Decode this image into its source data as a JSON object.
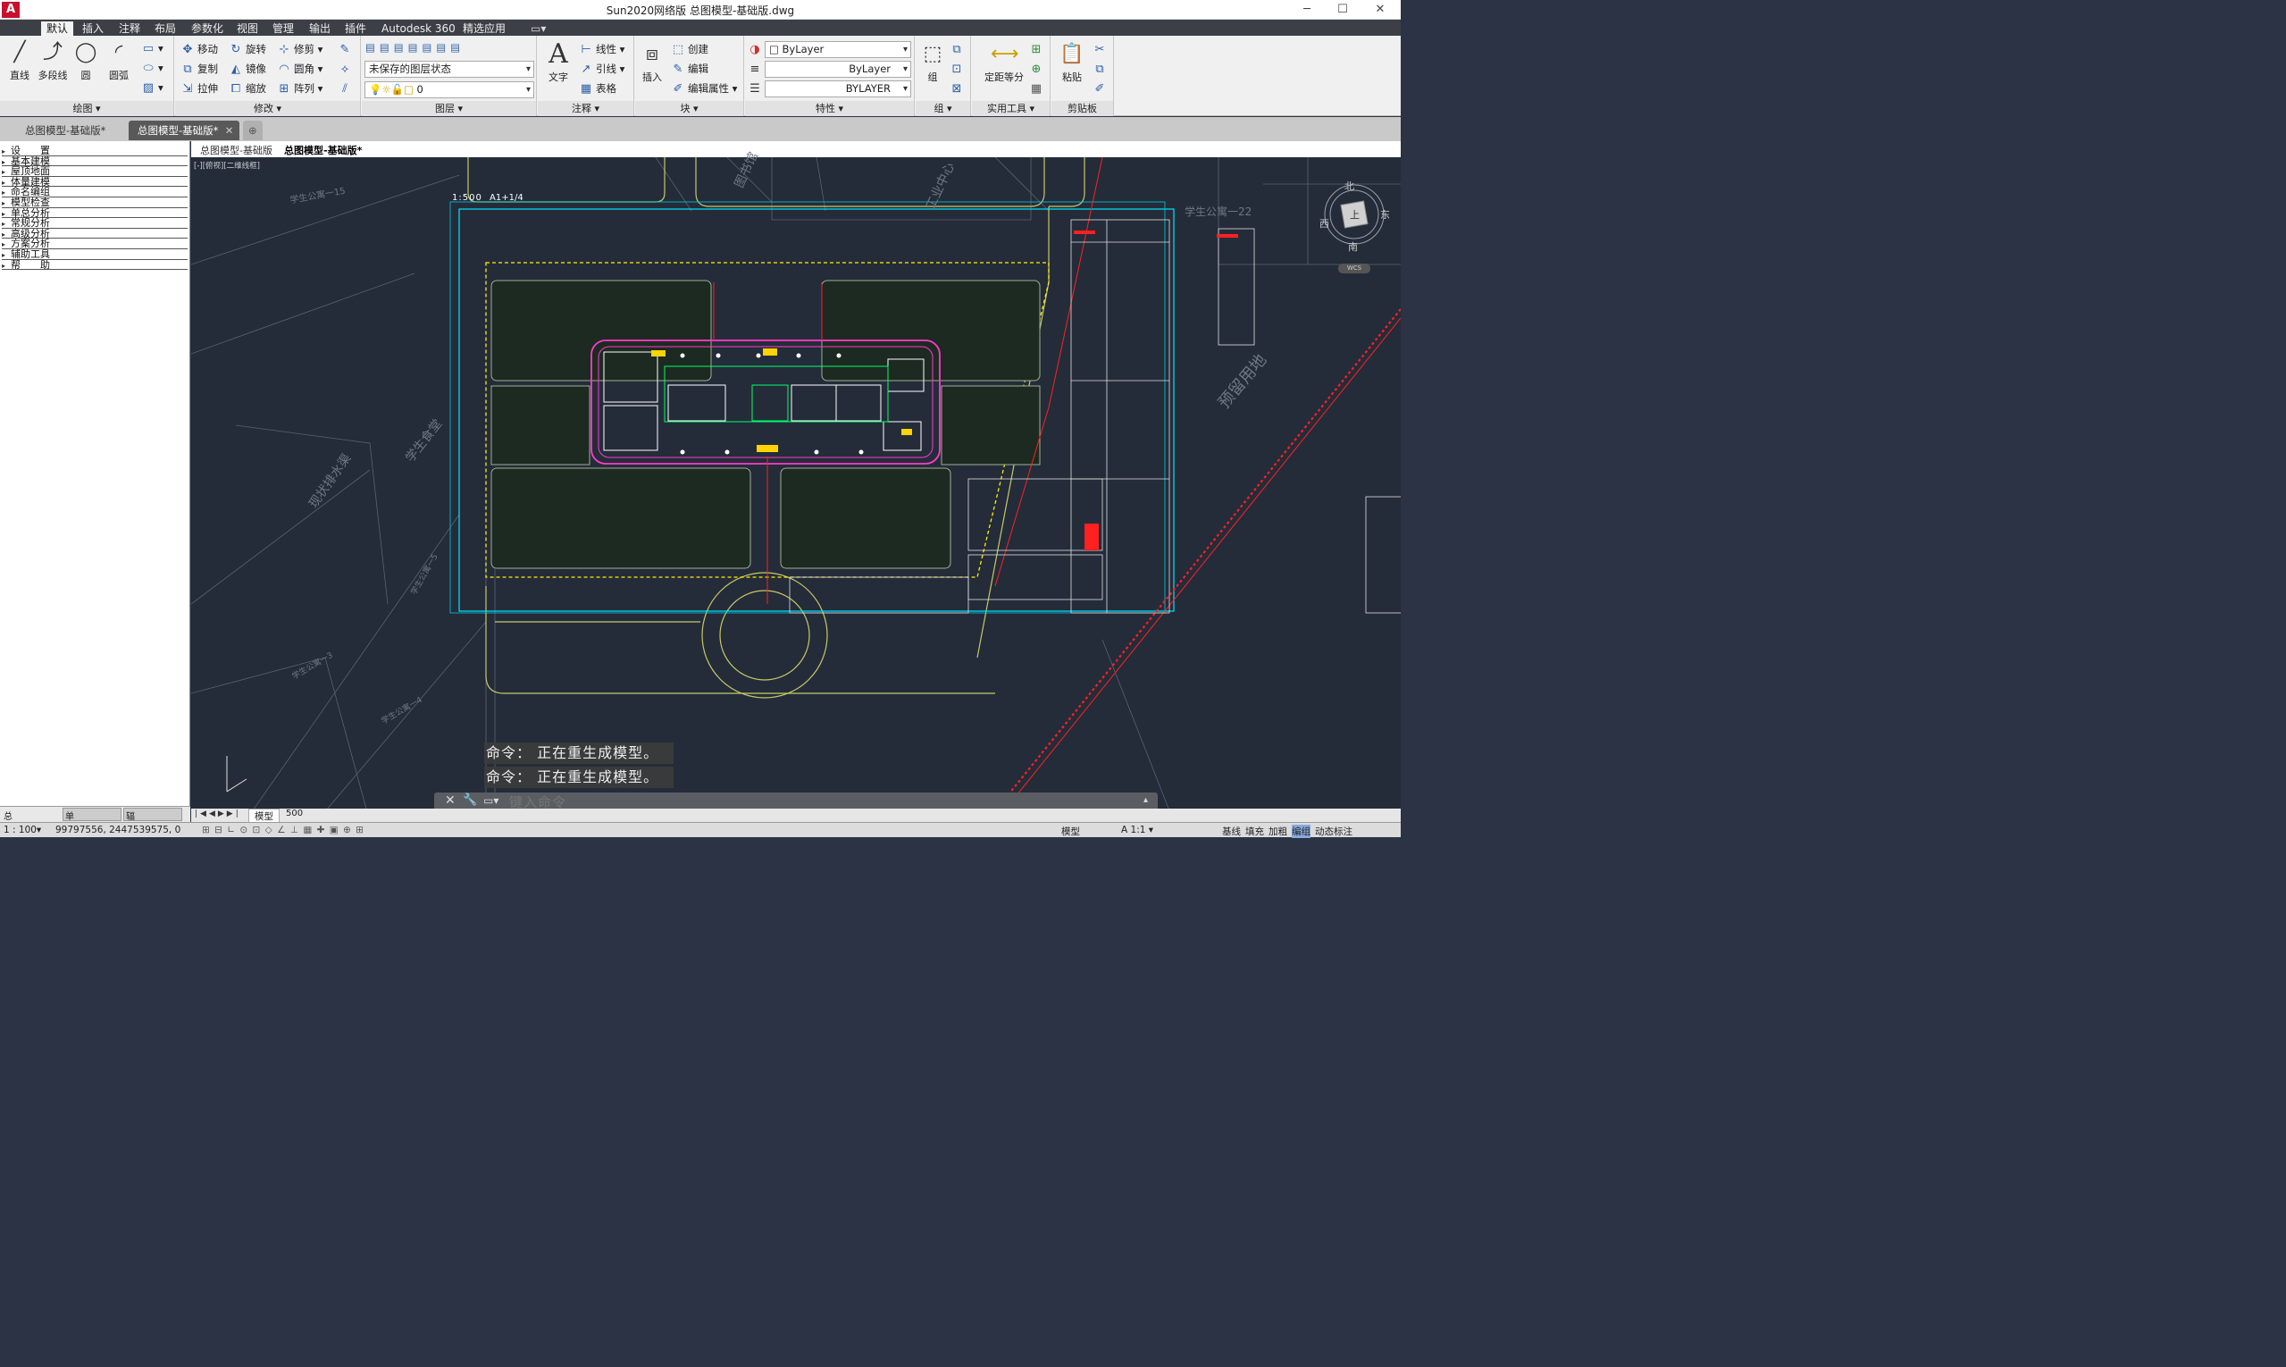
{
  "app": {
    "logo": "A",
    "title": "Sun2020网络版    总图模型-基础版.dwg",
    "win_min": "─",
    "win_max": "☐",
    "win_close": "✕"
  },
  "menu": [
    "默认",
    "插入",
    "注释",
    "布局",
    "参数化",
    "视图",
    "管理",
    "输出",
    "插件",
    "Autodesk 360",
    "精选应用"
  ],
  "ribbon": {
    "draw": {
      "label": "绘图 ▾",
      "line": "直线",
      "polyline": "多段线",
      "circle": "圆",
      "arc": "圆弧"
    },
    "modify": {
      "label": "修改 ▾",
      "move": "移动",
      "rotate": "旋转",
      "trim": "修剪",
      "copy": "复制",
      "mirror": "镜像",
      "fillet": "圆角",
      "stretch": "拉伸",
      "scale": "缩放",
      "array": "阵列"
    },
    "layer": {
      "label": "图层 ▾",
      "state": "未保存的图层状态",
      "current": "0"
    },
    "annotation": {
      "label": "注释 ▾",
      "text": "文字",
      "linear": "线性",
      "leader": "引线",
      "table": "表格"
    },
    "block": {
      "label": "块 ▾",
      "insert": "插入",
      "create": "创建",
      "edit": "编辑",
      "edit_attr": "编辑属性"
    },
    "properties": {
      "label": "特性 ▾",
      "color": "ByLayer",
      "linetype": "ByLayer",
      "lineweight": "BYLAYER"
    },
    "group": {
      "label": "组 ▾",
      "group": "组"
    },
    "utilities": {
      "label": "实用工具 ▾",
      "measure": "定距等分"
    },
    "clipboard": {
      "label": "剪贴板",
      "paste": "粘贴"
    }
  },
  "doctabs": [
    "总图模型-基础版*",
    "总图模型-基础版*"
  ],
  "leftpanel": [
    "设　　置",
    "基本建模",
    "屋顶地面",
    "体量建模",
    "命名编组",
    "模型检查",
    "单总分析",
    "常规分析",
    "高级分析",
    "方案分析",
    "辅助工具",
    "帮　　助"
  ],
  "leftpanel_bottom": {
    "left": "总",
    "tab1": "单",
    "tab2": "辐"
  },
  "viewport": {
    "tab_model": "总图模型-基础版",
    "tab_active": "总图模型-基础版*",
    "view_label": "[-][俯视][二维线框]",
    "scale_label": "1:500",
    "sheet_label": "A1+1/4",
    "compass": {
      "n": "北",
      "s": "南",
      "e": "东",
      "w": "西",
      "top": "上",
      "wcs": "WCS"
    },
    "labels": [
      "学生公寓一15",
      "图书馆",
      "工业中心",
      "学生公寓一22",
      "学生食堂",
      "现状排水渠",
      "预留用地",
      "学生公寓一3",
      "学生公寓一4",
      "学生公寓一5"
    ],
    "layout_tabs": [
      "模型",
      "500"
    ]
  },
  "command": {
    "history": [
      "命令：  正在重生成模型。",
      "命令：  正在重生成模型。"
    ],
    "placeholder": "键入命令"
  },
  "status": {
    "scale": "1 : 100▾",
    "coords": "99797556,  2447539575,  0",
    "model": "模型",
    "annoscale": "A 1:1 ▾",
    "items": [
      "基线",
      "填充",
      "加粗",
      "编组",
      "动态标注"
    ]
  }
}
